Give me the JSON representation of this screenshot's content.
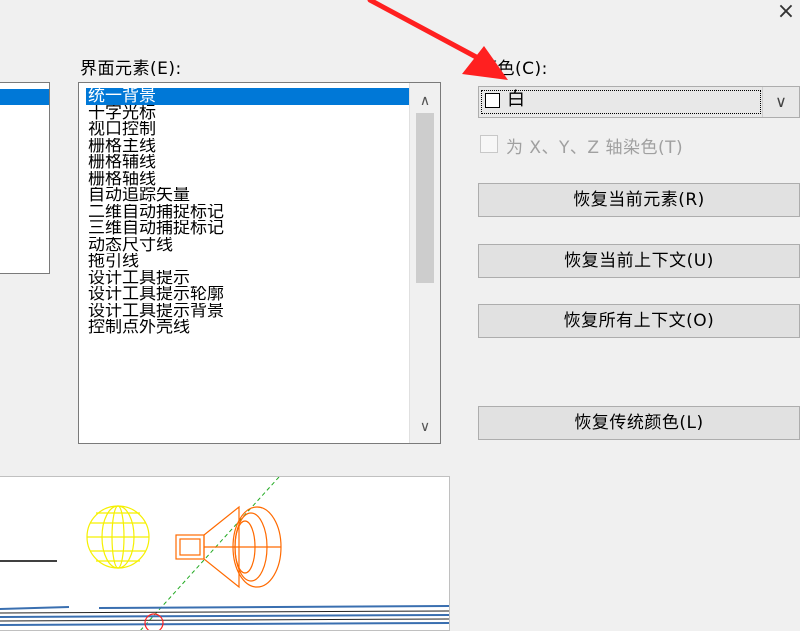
{
  "dialog": {
    "close_glyph": "×"
  },
  "labels": {
    "interface_elements": "界面元素(E):",
    "color": "颜色(C):"
  },
  "elements_list": {
    "items": [
      "统一背景",
      "十字光标",
      "视口控制",
      "栅格主线",
      "栅格辅线",
      "栅格轴线",
      "自动追踪矢量",
      "二维自动捕捉标记",
      "三维自动捕捉标记",
      "动态尺寸线",
      "拖引线",
      "设计工具提示",
      "设计工具提示轮廓",
      "设计工具提示背景",
      "控制点外壳线"
    ],
    "selected_index": 0
  },
  "color_select": {
    "value": "白"
  },
  "checkbox": {
    "label": "为 X、Y、Z 轴染色(T)",
    "checked": false,
    "enabled": false
  },
  "buttons": {
    "restore_current_element": "恢复当前元素(R)",
    "restore_current_context": "恢复当前上下文(U)",
    "restore_all_contexts": "恢复所有上下文(O)",
    "restore_classic_colors": "恢复传统颜色(L)"
  },
  "colors": {
    "selection": "#0078d7",
    "annotation_arrow": "#ff2020",
    "preview_yellow": "#f5f000",
    "preview_orange": "#ff6a00",
    "preview_green": "#22aa22"
  }
}
